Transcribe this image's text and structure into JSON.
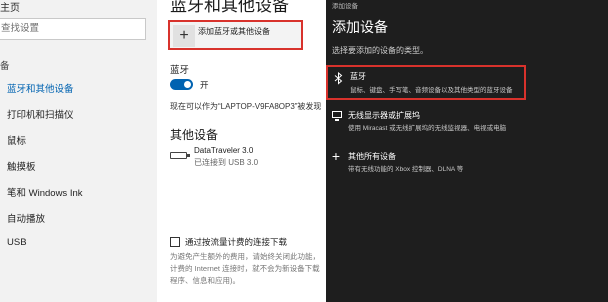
{
  "sidebar": {
    "home": "主页",
    "search_placeholder": "查找设置",
    "section": "备",
    "items": [
      {
        "label": "蓝牙和其他设备",
        "active": true
      },
      {
        "label": "打印机和扫描仪"
      },
      {
        "label": "鼠标"
      },
      {
        "label": "触摸板"
      },
      {
        "label": "笔和 Windows Ink"
      },
      {
        "label": "自动播放"
      },
      {
        "label": "USB"
      }
    ]
  },
  "main": {
    "title": "蓝牙和其他设备",
    "add_device_label": "添加蓝牙或其他设备",
    "bluetooth_heading": "蓝牙",
    "bluetooth_state": "开",
    "discoverable": "现在可以作为“LAPTOP-V9FA8OP3”被发现",
    "other_devices_heading": "其他设备",
    "device": {
      "name": "DataTraveler 3.0",
      "status": "已连接到 USB 3.0"
    },
    "metered_label": "通过按流量计费的连接下载",
    "metered_desc": [
      "为避免产生额外的费用，请始终关闭此功能，",
      "计费的 Internet 连接时，就不会为新设备下载",
      "程序、信息和应用)。"
    ]
  },
  "dialog": {
    "caption": "添加设备",
    "title": "添加设备",
    "subtitle": "选择要添加的设备的类型。",
    "options": [
      {
        "icon": "bluetooth-icon",
        "title": "蓝牙",
        "desc": "鼠标、键盘、手写笔、音频设备以及其他类型的蓝牙设备"
      },
      {
        "icon": "monitor-icon",
        "title": "无线显示器或扩展坞",
        "desc": "使用 Miracast 或无线扩展坞的无线监视器、电视或电脑"
      },
      {
        "icon": "plus-icon",
        "title": "其他所有设备",
        "desc": "带有无线功能的 Xbox 控制器、DLNA 等"
      }
    ]
  },
  "colors": {
    "accent": "#0063b1",
    "highlight_border": "#d8322c",
    "dialog_bg": "#1e1e1e"
  }
}
